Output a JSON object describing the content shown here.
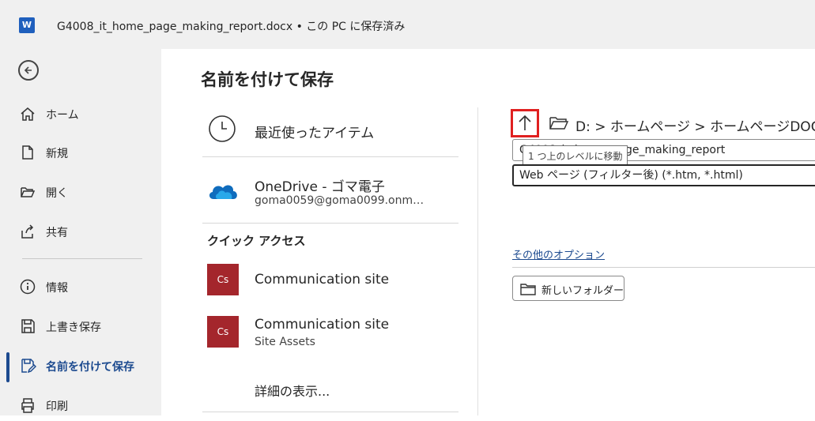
{
  "titlebar": {
    "logo_letter": "W",
    "document_title": "G4008_it_home_page_making_report.docx • この PC に保存済み"
  },
  "nav": {
    "items": [
      {
        "label": "ホーム",
        "icon": "home-icon"
      },
      {
        "label": "新規",
        "icon": "new-document-icon"
      },
      {
        "label": "開く",
        "icon": "folder-open-icon"
      },
      {
        "label": "共有",
        "icon": "share-icon"
      },
      {
        "label": "情報",
        "icon": "info-icon"
      },
      {
        "label": "上書き保存",
        "icon": "save-icon"
      },
      {
        "label": "名前を付けて保存",
        "icon": "save-as-icon",
        "active": true
      },
      {
        "label": "印刷",
        "icon": "print-icon"
      }
    ]
  },
  "main": {
    "title": "名前を付けて保存",
    "locations": {
      "recent": "最近使ったアイテム",
      "onedrive_label": "OneDrive - ゴマ電子",
      "onedrive_account": "goma0059@goma0099.onm…",
      "quick_access": "クイック アクセス",
      "cs_tile": "Cs",
      "site1": "Communication site",
      "site2": "Communication site",
      "site2_sub": "Site Assets",
      "more": "詳細の表示..."
    },
    "save_panel": {
      "breadcrumb": "D: > ホームページ > ホームページDOC",
      "filename": "G4008_it_home_page_making_report",
      "tooltip": "1 つ上のレベルに移動",
      "filetype": "Web ページ (フィルター後) (*.htm, *.html)",
      "more_options": "その他のオプション",
      "new_folder": "新しいフォルダー"
    }
  },
  "colors": {
    "accent": "#1c4a8f",
    "highlight_box": "#e02020",
    "site_tile": "#a4262c",
    "onedrive": "#0f6cbd"
  }
}
